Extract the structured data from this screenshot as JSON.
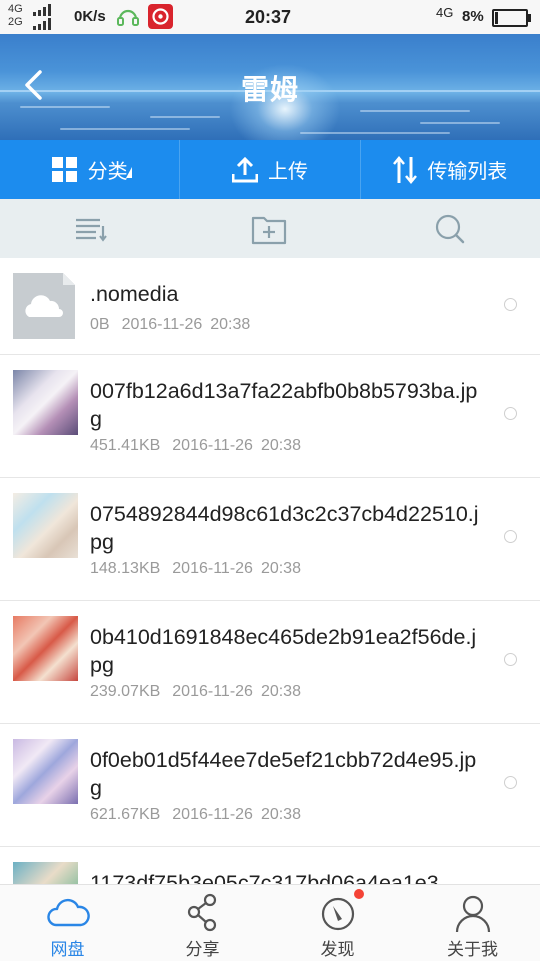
{
  "status_bar": {
    "network_top": "4G",
    "network_bottom": "2G",
    "speed": "0K/s",
    "time": "20:37",
    "network_right": "4G",
    "battery": "8%"
  },
  "header": {
    "title": "雷姆"
  },
  "actions": {
    "category": "分类",
    "upload": "上传",
    "transfer_list": "传输列表"
  },
  "files": [
    {
      "name": ".nomedia",
      "size": "0B",
      "date": "2016-11-26",
      "time": "20:38",
      "thumb": "cloud-placeholder"
    },
    {
      "name": "007fb12a6d13a7fa22abfb0b8b5793ba.jpg",
      "size": "451.41KB",
      "date": "2016-11-26",
      "time": "20:38",
      "thumb": "anime-image"
    },
    {
      "name": "0754892844d98c61d3c2c37cb4d22510.jpg",
      "size": "148.13KB",
      "date": "2016-11-26",
      "time": "20:38",
      "thumb": "anime-image"
    },
    {
      "name": "0b410d1691848ec465de2b91ea2f56de.jpg",
      "size": "239.07KB",
      "date": "2016-11-26",
      "time": "20:38",
      "thumb": "anime-image"
    },
    {
      "name": "0f0eb01d5f44ee7de5ef21cbb72d4e95.jpg",
      "size": "621.67KB",
      "date": "2016-11-26",
      "time": "20:38",
      "thumb": "anime-image"
    },
    {
      "name": "1173df75b3e05c7c317bd06a4ea1e3",
      "size": "",
      "date": "",
      "time": "",
      "thumb": "anime-image"
    }
  ],
  "nav": {
    "netdisk": "网盘",
    "share": "分享",
    "discover": "发现",
    "about": "关于我"
  },
  "colors": {
    "accent": "#1c8cee",
    "active_nav": "#2a86e6",
    "badge": "#f44336"
  }
}
